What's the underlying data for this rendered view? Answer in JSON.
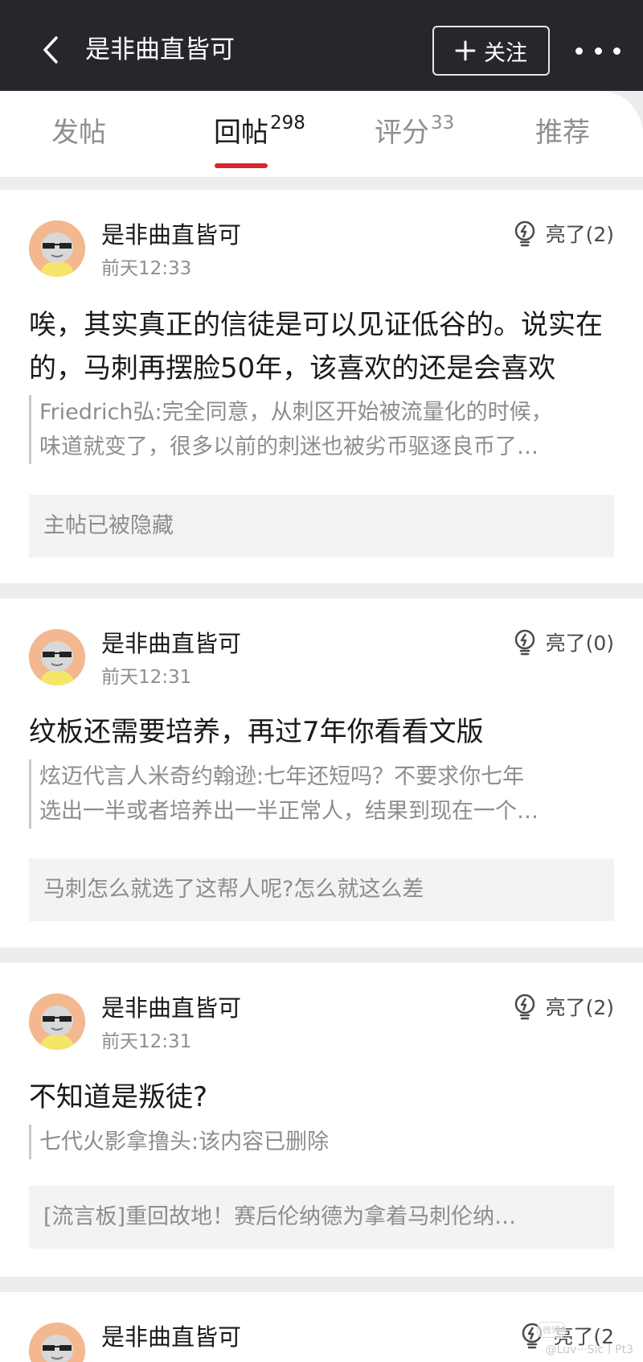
{
  "header": {
    "title": "是非曲直皆可",
    "follow_label": "关注"
  },
  "tabs": [
    {
      "label": "发帖",
      "count": ""
    },
    {
      "label": "回帖",
      "count": "298"
    },
    {
      "label": "评分",
      "count": "33"
    },
    {
      "label": "推荐",
      "count": ""
    }
  ],
  "replies": [
    {
      "author": "是非曲直皆可",
      "time": "前天12:33",
      "likes": "亮了(2)",
      "content": "唉，其实真正的信徒是可以见证低谷的。说实在的，马刺再摆脸50年，该喜欢的还是会喜欢",
      "quote": [
        "Friedrich弘:完全同意，从刺区开始被流量化的时候，",
        "味道就变了，很多以前的刺迷也被劣币驱逐良币了…"
      ],
      "ref": "主帖已被隐藏"
    },
    {
      "author": "是非曲直皆可",
      "time": "前天12:31",
      "likes": "亮了(0)",
      "content": "纹板还需要培养，再过7年你看看文版",
      "quote": [
        "炫迈代言人米奇约翰逊:七年还短吗？不要求你七年",
        "选出一半或者培养出一半正常人，结果到现在一个…"
      ],
      "ref": "马刺怎么就选了这帮人呢?怎么就这么差"
    },
    {
      "author": "是非曲直皆可",
      "time": "前天12:31",
      "likes": "亮了(2)",
      "content": "不知道是叛徒?",
      "quote": [
        "七代火影拿撸头:该内容已删除"
      ],
      "ref": "[流言板]重回故地！赛后伦纳德为拿着马刺伦纳…"
    },
    {
      "author": "是非曲直皆可",
      "likes": "亮了(2"
    }
  ],
  "watermark": "@Luv···Sic丨Pt3",
  "watermark_logo": "微博"
}
